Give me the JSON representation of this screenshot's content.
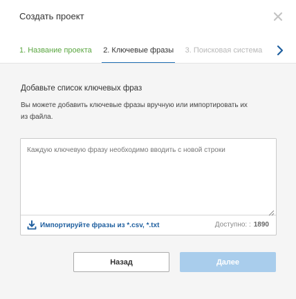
{
  "dialog": {
    "title": "Создать проект"
  },
  "steps": [
    {
      "label": "1. Название проекта",
      "state": "done"
    },
    {
      "label": "2. Ключевые фразы",
      "state": "active"
    },
    {
      "label": "3. Поисковая система",
      "state": "pending"
    }
  ],
  "content": {
    "heading": "Добавьте список ключевых фраз",
    "hint": "Вы можете добавить ключевые фразы вручную или импортировать их из файла.",
    "textarea_value": "",
    "textarea_placeholder": "Каждую ключевую фразу необходимо вводить с новой строки",
    "import_label": "Импортируйте фразы из *.csv, *.txt",
    "available_label": "Доступно: :",
    "available_count": "1890"
  },
  "buttons": {
    "back": "Назад",
    "next": "Далее"
  },
  "colors": {
    "done_step": "#5aa640",
    "active_underline": "#1f6fb5",
    "link": "#1f5f9f",
    "next_button_disabled": "#a9cdec"
  },
  "icons": {
    "close": "close-icon",
    "tabs_next": "chevron-right-icon",
    "import": "download-icon",
    "resize": "resize-grip-icon"
  }
}
